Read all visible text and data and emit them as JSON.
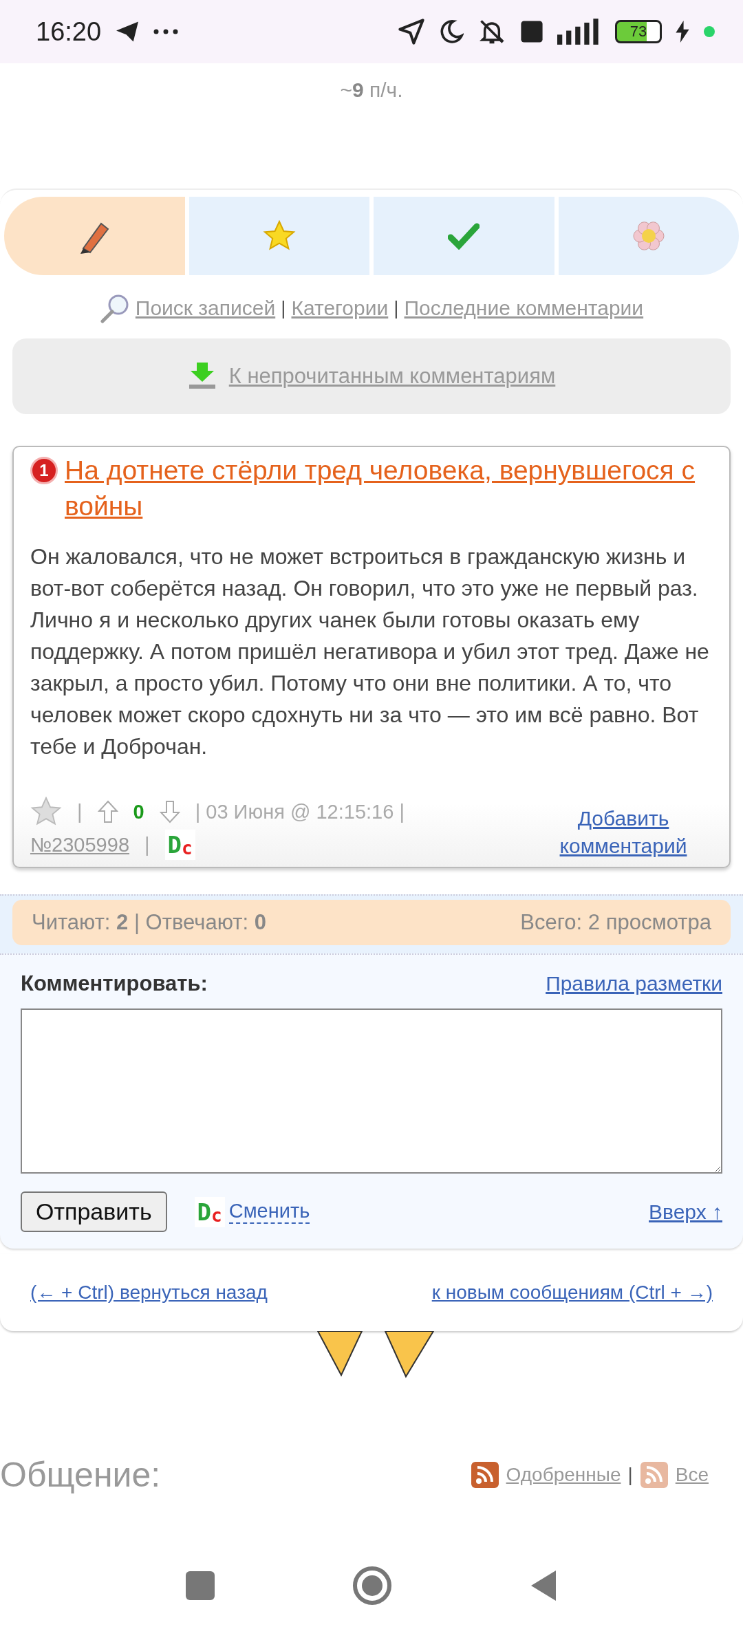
{
  "status_bar": {
    "time": "16:20",
    "battery": "73"
  },
  "top_text": "~**9** п/ч.",
  "tabs": [
    {
      "kind": "pencil",
      "selected": true
    },
    {
      "kind": "star",
      "selected": false
    },
    {
      "kind": "check",
      "selected": false
    },
    {
      "kind": "flower",
      "selected": false
    }
  ],
  "links": [
    "Поиск записей",
    "Категории",
    "Последние комментарии"
  ],
  "link_separator": "|",
  "unread_button": "К непрочитанным комментариям",
  "post": {
    "badge": "1",
    "title": "На дотнете стёрли тред человека, вернувшегося с войны",
    "body": "Он жаловался, что не может встроиться в гражданскую жизнь и вот-вот соберётся назад. Он говорил, что это уже не первый раз. Лично я и несколько других чанек были готовы оказать ему поддержку. А потом пришёл негативора и убил этот тред. Даже не закрыл, а просто убил. Потому что они вне политики. А то, что человек может скоро сдохнуть ни за что — это им всё равно. Вот тебе и Доброчан.",
    "footer": [
      {
        "kind": "star"
      },
      {
        "kind": "text",
        "text": "|"
      },
      {
        "kind": "up"
      },
      {
        "kind": "score",
        "text": "0"
      },
      {
        "kind": "down"
      },
      {
        "kind": "text",
        "text": "| 03 Июня @ 12:15:16 |"
      },
      {
        "kind": "link",
        "text": "№2305998"
      },
      {
        "kind": "text",
        "text": "|"
      },
      {
        "kind": "logo",
        "big": "D",
        "small": "c"
      }
    ],
    "reply_link": "Добавить комментарий"
  },
  "stats": {
    "left": "Читают: **2** | Отвечают: **0**",
    "right": "Всего: 2 просмотра"
  },
  "form": {
    "label": "Комментировать:",
    "rules_link": "Правила разметки",
    "submit": "Отправить",
    "logo": {
      "big": "D",
      "small": "c"
    },
    "change_link": "Сменить",
    "top_link": "Вверх ↑"
  },
  "nav": {
    "back": "(← + Ctrl) вернуться назад",
    "forward": "к новым сообщениям (Ctrl + →)"
  },
  "footer": {
    "heading": "Общение:",
    "feeds": [
      "Одобренные",
      "Все"
    ],
    "separator": "|"
  }
}
